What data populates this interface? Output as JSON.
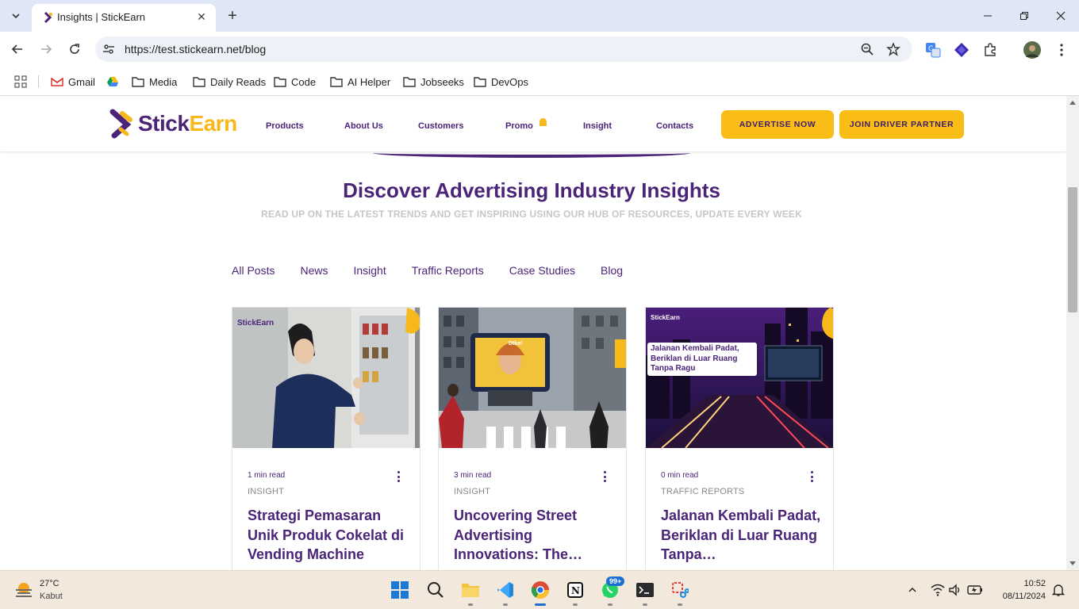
{
  "browser": {
    "tab_title": "Insights | StickEarn",
    "url": "https://test.stickearn.net/blog",
    "bookmarks": [
      "Gmail",
      "Media",
      "Daily Reads",
      "Code",
      "AI Helper",
      "Jobseeks",
      "DevOps"
    ]
  },
  "site": {
    "logo": {
      "stick": "Stick",
      "earn": "Earn"
    },
    "nav": [
      "Products",
      "About Us",
      "Customers",
      "Promo",
      "Insight",
      "Contacts"
    ],
    "cta_advertise": "ADVERTISE NOW",
    "cta_join": "JOIN DRIVER PARTNER",
    "hero_title": "Discover Advertising Industry Insights",
    "hero_subtitle": "READ UP ON THE LATEST TRENDS AND GET INSPIRING USING OUR HUB OF RESOURCES, UPDATE EVERY WEEK",
    "filters": [
      "All Posts",
      "News",
      "Insight",
      "Traffic Reports",
      "Case Studies",
      "Blog"
    ],
    "cards": [
      {
        "read_time": "1 min read",
        "category": "INSIGHT",
        "title": "Strategi Pemasaran Unik Produk Cokelat di Vending Machine",
        "img_label": "StickEarn"
      },
      {
        "read_time": "3 min read",
        "category": "INSIGHT",
        "title": "Uncovering Street Advertising Innovations: The…",
        "img_label": "Dtke!"
      },
      {
        "read_time": "0 min read",
        "category": "TRAFFIC REPORTS",
        "title": "Jalanan Kembali Padat, Beriklan di Luar Ruang Tanpa…",
        "img_label": "StickEarn",
        "img_overlay": "Jalanan Kembali Padat, Beriklan di Luar Ruang Tanpa Ragu"
      }
    ]
  },
  "taskbar": {
    "temperature": "27°C",
    "condition": "Kabut",
    "whatsapp_badge": "99+",
    "time": "10:52",
    "date": "08/11/2024"
  },
  "colors": {
    "brand_purple": "#4b2478",
    "brand_yellow": "#f9bd15"
  }
}
